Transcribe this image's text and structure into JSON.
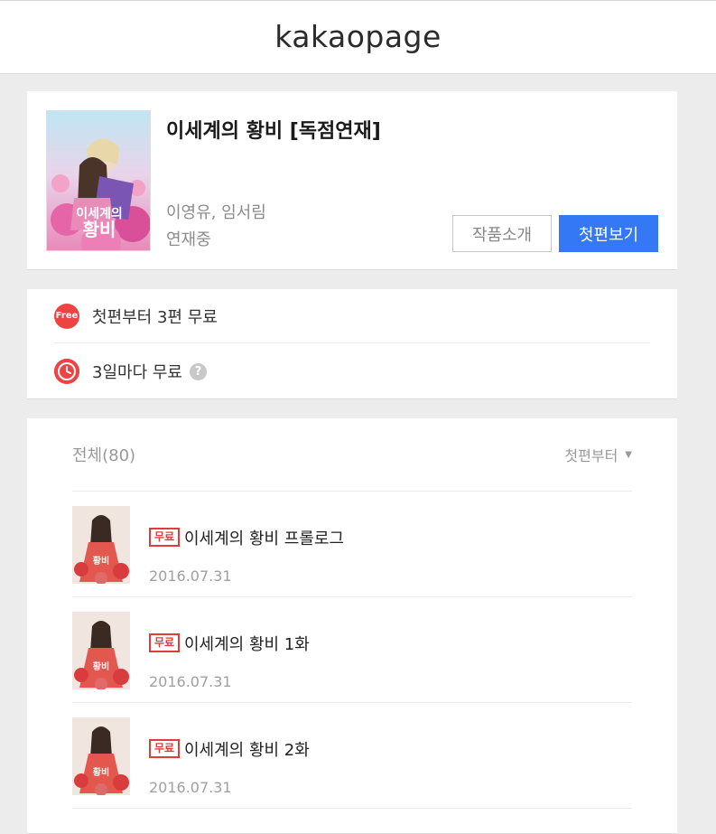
{
  "header": {
    "logo": "kakaopage"
  },
  "work": {
    "title": "이세계의 황비 [독점연재]",
    "authors": "이영유, 임서림",
    "status": "연재중",
    "cover_icon": "cover-illustration",
    "buttons": {
      "intro": "작품소개",
      "first": "첫편보기"
    }
  },
  "free": {
    "first_badge": "Free",
    "first_text": "첫편부터 3편 무료",
    "wait_text": "3일마다 무료",
    "help": "?"
  },
  "list": {
    "total": "전체(80)",
    "sort": "첫편부터",
    "sort_caret": "▼",
    "episodes": [
      {
        "badge": "무료",
        "title": "이세계의 황비 프롤로그",
        "date": "2016.07.31"
      },
      {
        "badge": "무료",
        "title": "이세계의 황비 1화",
        "date": "2016.07.31"
      },
      {
        "badge": "무료",
        "title": "이세계의 황비 2화",
        "date": "2016.07.31"
      }
    ]
  },
  "colors": {
    "accent": "#3478f6",
    "free_red": "#ee4343",
    "background": "#ececec"
  }
}
